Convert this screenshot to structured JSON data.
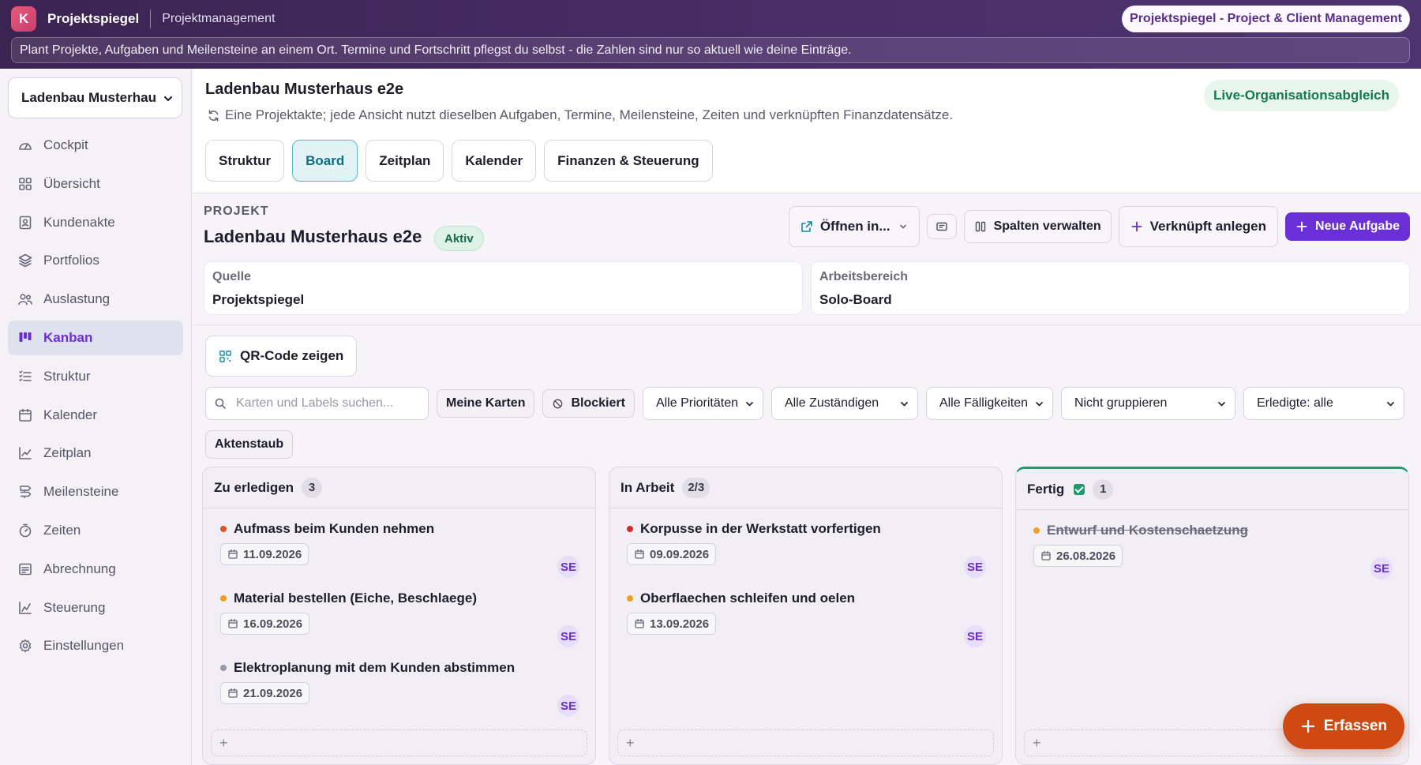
{
  "topbar": {
    "logo_letter": "K",
    "app_name": "Projektspiegel",
    "section": "Projektmanagement",
    "product_pill": "Projektspiegel - Project & Client Management",
    "banner": "Plant Projekte, Aufgaben und Meilensteine an einem Ort. Termine und Fortschritt pflegst du selbst - die Zahlen sind nur so aktuell wie deine Einträge."
  },
  "sidebar": {
    "org_select": "Ladenbau Musterhau",
    "items": [
      {
        "label": "Cockpit",
        "icon": "gauge-icon"
      },
      {
        "label": "Übersicht",
        "icon": "grid-icon"
      },
      {
        "label": "Kundenakte",
        "icon": "contact-card-icon"
      },
      {
        "label": "Portfolios",
        "icon": "layers-icon"
      },
      {
        "label": "Auslastung",
        "icon": "users-icon"
      },
      {
        "label": "Kanban",
        "icon": "kanban-icon",
        "active": true
      },
      {
        "label": "Struktur",
        "icon": "list-tree-icon"
      },
      {
        "label": "Kalender",
        "icon": "calendar-icon"
      },
      {
        "label": "Zeitplan",
        "icon": "chart-line-icon"
      },
      {
        "label": "Meilensteine",
        "icon": "milestone-icon"
      },
      {
        "label": "Zeiten",
        "icon": "timer-icon"
      },
      {
        "label": "Abrechnung",
        "icon": "receipt-icon"
      },
      {
        "label": "Steuerung",
        "icon": "trend-icon"
      },
      {
        "label": "Einstellungen",
        "icon": "gear-icon"
      }
    ]
  },
  "header": {
    "title": "Ladenbau Musterhaus e2e",
    "description": "Eine Projektakte; jede Ansicht nutzt dieselben Aufgaben, Termine, Meilensteine, Zeiten und verknüpften Finanzdatensätze.",
    "live_pill": "Live-Organisationsabgleich",
    "tabs": [
      "Struktur",
      "Board",
      "Zeitplan",
      "Kalender",
      "Finanzen & Steuerung"
    ],
    "active_tab": "Board"
  },
  "project": {
    "section_label": "PROJEKT",
    "name": "Ladenbau Musterhaus e2e",
    "status": "Aktiv",
    "toolbar": {
      "open_in": "Öffnen in...",
      "manage_columns": "Spalten verwalten",
      "linked_create": "Verknüpft anlegen",
      "new_task": "Neue Aufgabe"
    },
    "meta": [
      {
        "label": "Quelle",
        "value": "Projektspiegel"
      },
      {
        "label": "Arbeitsbereich",
        "value": "Solo-Board"
      }
    ],
    "qr_button": "QR-Code zeigen"
  },
  "filters": {
    "search_placeholder": "Karten und Labels suchen...",
    "my_cards": "Meine Karten",
    "blocked": "Blockiert",
    "priority": "Alle Prioritäten",
    "assignee": "Alle Zuständigen",
    "due": "Alle Fälligkeiten",
    "group": "Nicht gruppieren",
    "done": "Erledigte: alle",
    "aktenstaub": "Aktenstaub"
  },
  "colors": {
    "accent": "#6a2fd6",
    "prio_high": "#e0502a",
    "prio_medium": "#f0a020",
    "prio_low": "#9a97a6",
    "prio_critical": "#d42a2a",
    "done_accent": "#1f9a6a",
    "fab": "#cf4a12"
  },
  "board": {
    "columns": [
      {
        "title": "Zu erledigen",
        "count": "3",
        "cards": [
          {
            "title": "Aufmass beim Kunden nehmen",
            "date": "11.09.2026",
            "assignee": "SE",
            "prio_color": "#e0502a"
          },
          {
            "title": "Material bestellen (Eiche, Beschlaege)",
            "date": "16.09.2026",
            "assignee": "SE",
            "prio_color": "#f0a020"
          },
          {
            "title": "Elektroplanung mit dem Kunden abstimmen",
            "date": "21.09.2026",
            "assignee": "SE",
            "prio_color": "#9a97a6"
          }
        ]
      },
      {
        "title": "In Arbeit",
        "count": "2/3",
        "cards": [
          {
            "title": "Korpusse in der Werkstatt vorfertigen",
            "date": "09.09.2026",
            "assignee": "SE",
            "prio_color": "#d42a2a"
          },
          {
            "title": "Oberflaechen schleifen und oelen",
            "date": "13.09.2026",
            "assignee": "SE",
            "prio_color": "#f0a020"
          }
        ]
      },
      {
        "title": "Fertig",
        "count": "1",
        "done": true,
        "cards": [
          {
            "title": "Entwurf und Kostenschaetzung",
            "date": "26.08.2026",
            "assignee": "SE",
            "prio_color": "#f0a020",
            "done": true
          }
        ]
      }
    ],
    "add_symbol": "+"
  },
  "fab": {
    "label": "Erfassen"
  }
}
